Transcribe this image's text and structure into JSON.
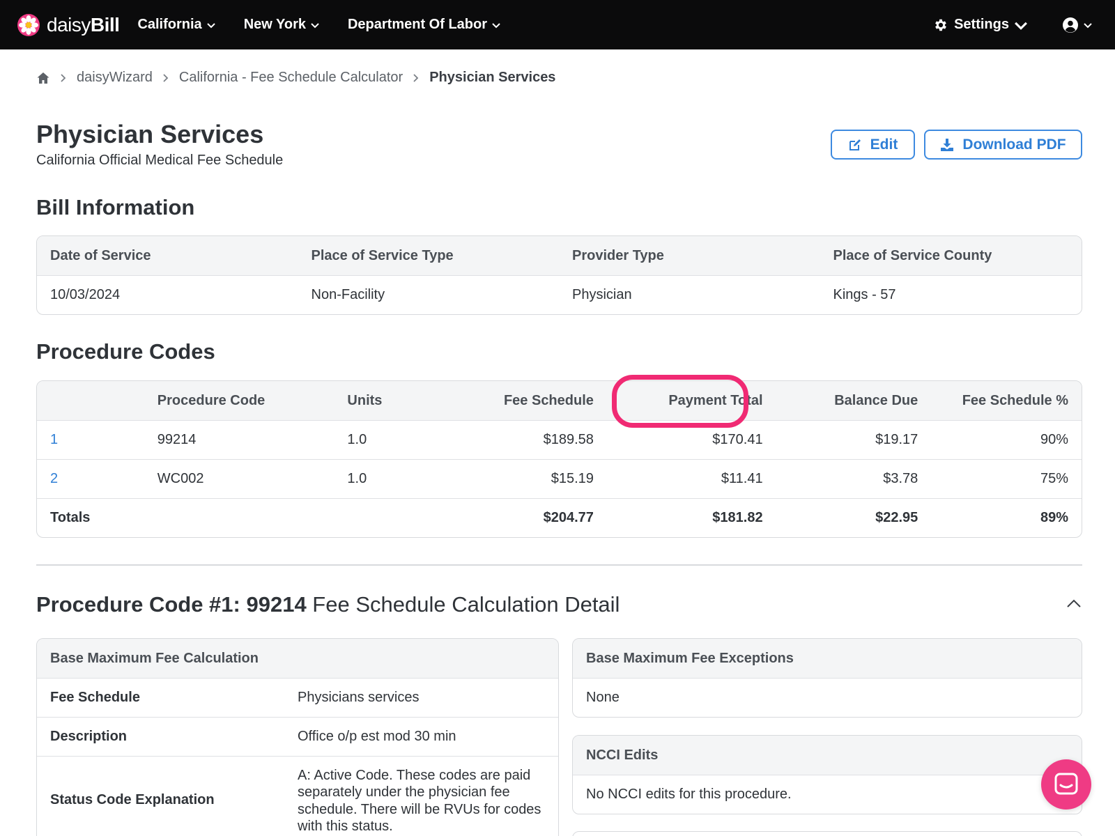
{
  "brand": {
    "name_light": "daisy",
    "name_bold": "Bill",
    "accent": "#f02a73"
  },
  "nav": {
    "items": [
      {
        "label": "California"
      },
      {
        "label": "New York"
      },
      {
        "label": "Department Of Labor"
      }
    ],
    "settings_label": "Settings"
  },
  "breadcrumb": {
    "items": [
      "daisyWizard",
      "California - Fee Schedule Calculator"
    ],
    "current": "Physician Services"
  },
  "header": {
    "title": "Physician Services",
    "subtitle": "California Official Medical Fee Schedule",
    "edit_label": "Edit",
    "download_label": "Download PDF"
  },
  "bill": {
    "title": "Bill Information",
    "columns": [
      "Date of Service",
      "Place of Service Type",
      "Provider Type",
      "Place of Service County"
    ],
    "values": [
      "10/03/2024",
      "Non-Facility",
      "Physician",
      "Kings - 57"
    ]
  },
  "procedures": {
    "title": "Procedure Codes",
    "columns": [
      "",
      "Procedure Code",
      "Units",
      "Fee Schedule",
      "Payment Total",
      "Balance Due",
      "Fee Schedule %"
    ],
    "rows": [
      [
        "1",
        "99214",
        "1.0",
        "$189.58",
        "$170.41",
        "$19.17",
        "90%"
      ],
      [
        "2",
        "WC002",
        "1.0",
        "$15.19",
        "$11.41",
        "$3.78",
        "75%"
      ]
    ],
    "totals": [
      "Totals",
      "",
      "",
      "$204.77",
      "$181.82",
      "$22.95",
      "89%"
    ]
  },
  "detail": {
    "title_bold": "Procedure Code #1: 99214",
    "title_rest": " Fee Schedule Calculation Detail",
    "base_calc": {
      "title": "Base Maximum Fee Calculation",
      "rows": [
        {
          "key": "Fee Schedule",
          "value": "Physicians services"
        },
        {
          "key": "Description",
          "value": "Office o/p est mod 30 min"
        },
        {
          "key": "Status Code Explanation",
          "value": "A: Active Code. These codes are paid separately under the physician fee schedule. There will be RVUs for codes with this status."
        }
      ]
    },
    "exceptions": {
      "title": "Base Maximum Fee Exceptions",
      "value": "None"
    },
    "ncci": {
      "title": "NCCI Edits",
      "value": "No NCCI edits for this procedure."
    }
  }
}
